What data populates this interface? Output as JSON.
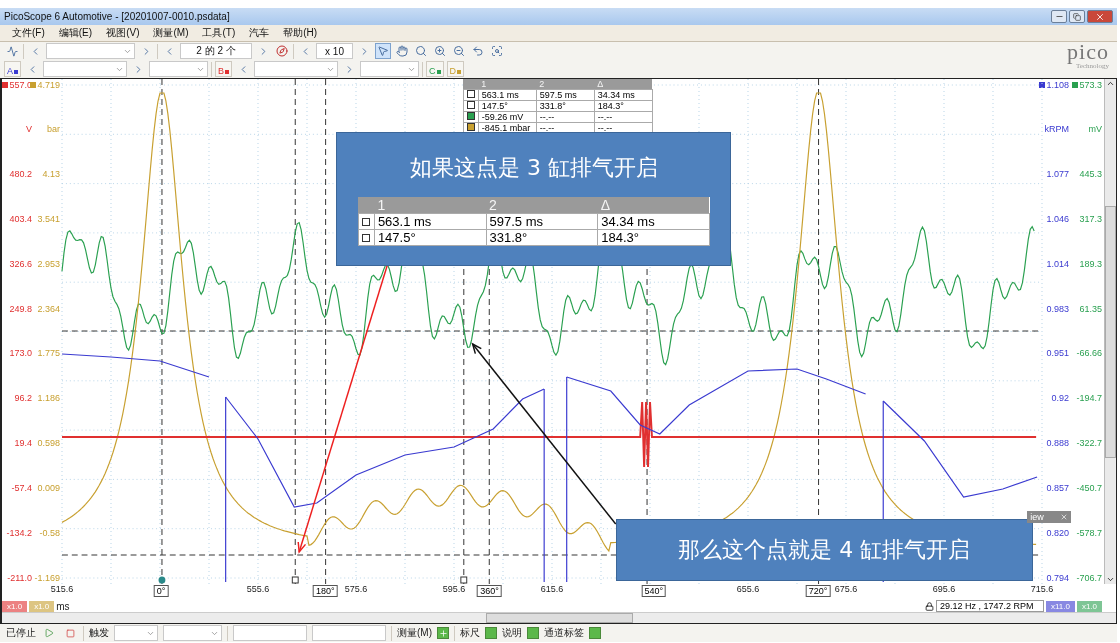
{
  "window": {
    "title": "PicoScope 6 Automotive - [20201007-0010.psdata]"
  },
  "menu": [
    "文件(F)",
    "编辑(E)",
    "视图(V)",
    "测量(M)",
    "工具(T)",
    "汽车",
    "帮助(H)"
  ],
  "toolbar": {
    "page": "2 的 2 个",
    "zoom": "x 10",
    "tools": [
      {
        "kind": "pointer",
        "selected": true
      },
      {
        "kind": "hand",
        "selected": false
      },
      {
        "kind": "zoom",
        "selected": false
      },
      {
        "kind": "zoom-in",
        "selected": false
      },
      {
        "kind": "zoom-out",
        "selected": false
      },
      {
        "kind": "undo",
        "selected": false
      },
      {
        "kind": "zoom-fit",
        "selected": false
      }
    ]
  },
  "channels": [
    {
      "label": "A",
      "color": "#3a3ad0"
    },
    {
      "label": "B",
      "color": "#e03030"
    },
    {
      "label": "C",
      "color": "#2aa050"
    },
    {
      "label": "D",
      "color": "#c8a030"
    }
  ],
  "logo": {
    "name": "pico",
    "tagline": "Technology"
  },
  "axes_left": [
    {
      "unit": "V",
      "color": "#e03030",
      "scale": "x1.0",
      "ticks": [
        "557.0",
        "480.2",
        "403.4",
        "326.6",
        "249.8",
        "173.0",
        "96.2",
        "19.4",
        "-57.4",
        "-134.2",
        "-211.0"
      ]
    },
    {
      "unit": "bar",
      "color": "#c8a030",
      "scale": "x1.0",
      "ticks": [
        "4.719",
        "4.13",
        "3.541",
        "2.953",
        "2.364",
        "1.775",
        "1.186",
        "0.598",
        "0.009",
        "-0.58",
        "-1.169"
      ]
    }
  ],
  "axes_right": [
    {
      "unit": "kRPM",
      "color": "#3a3ad0",
      "scale": "x11.0",
      "ticks": [
        "1.108",
        "1.077",
        "1.046",
        "1.014",
        "0.983",
        "0.951",
        "0.92",
        "0.888",
        "0.857",
        "0.820",
        "0.794"
      ]
    },
    {
      "unit": "mV",
      "color": "#2aa050",
      "scale": "x1.0",
      "ticks": [
        "573.3",
        "445.3",
        "317.3",
        "189.3",
        "61.35",
        "-66.66",
        "-194.7",
        "-322.7",
        "-450.7",
        "-578.7",
        "-706.7"
      ]
    }
  ],
  "x_axis": {
    "unit": "ms",
    "ticks": [
      "515.6",
      "555.6",
      "575.6",
      "595.6",
      "615.6",
      "655.6",
      "675.6",
      "695.6",
      "715.6"
    ]
  },
  "rulers": [
    "0°",
    "180°",
    "360°",
    "540°",
    "720°"
  ],
  "measurements": {
    "columns": [
      "1",
      "2",
      "Δ"
    ],
    "rows": [
      {
        "kind": "time",
        "cells": [
          "563.1 ms",
          "597.5 ms",
          "34.34 ms"
        ]
      },
      {
        "kind": "angle",
        "cells": [
          "147.5°",
          "331.8°",
          "184.3°"
        ]
      },
      {
        "kind": "green",
        "cells": [
          "-59.26 mV",
          "--.--",
          "--.--"
        ]
      },
      {
        "kind": "tan",
        "cells": [
          "-845.1 mbar",
          "--.--",
          "--.--"
        ]
      }
    ]
  },
  "callouts": [
    {
      "text": "如果这点是 3 缸排气开启",
      "columns": [
        "1",
        "2",
        "Δ"
      ],
      "rows": [
        [
          "563.1 ms",
          "597.5 ms",
          "34.34 ms"
        ],
        [
          "147.5°",
          "331.8°",
          "184.3°"
        ]
      ]
    },
    {
      "text": "那么这个点就是 4 缸排气开启"
    }
  ],
  "hidden_panel": {
    "title": "iew"
  },
  "readout": "29.12 Hz , 1747.2 RPM",
  "bottom_toolbar": {
    "status": "已停止",
    "trigger": "触发",
    "measure": "测量(M)",
    "ruler": "标尺",
    "notes": "说明",
    "labels": "通道标签"
  }
}
